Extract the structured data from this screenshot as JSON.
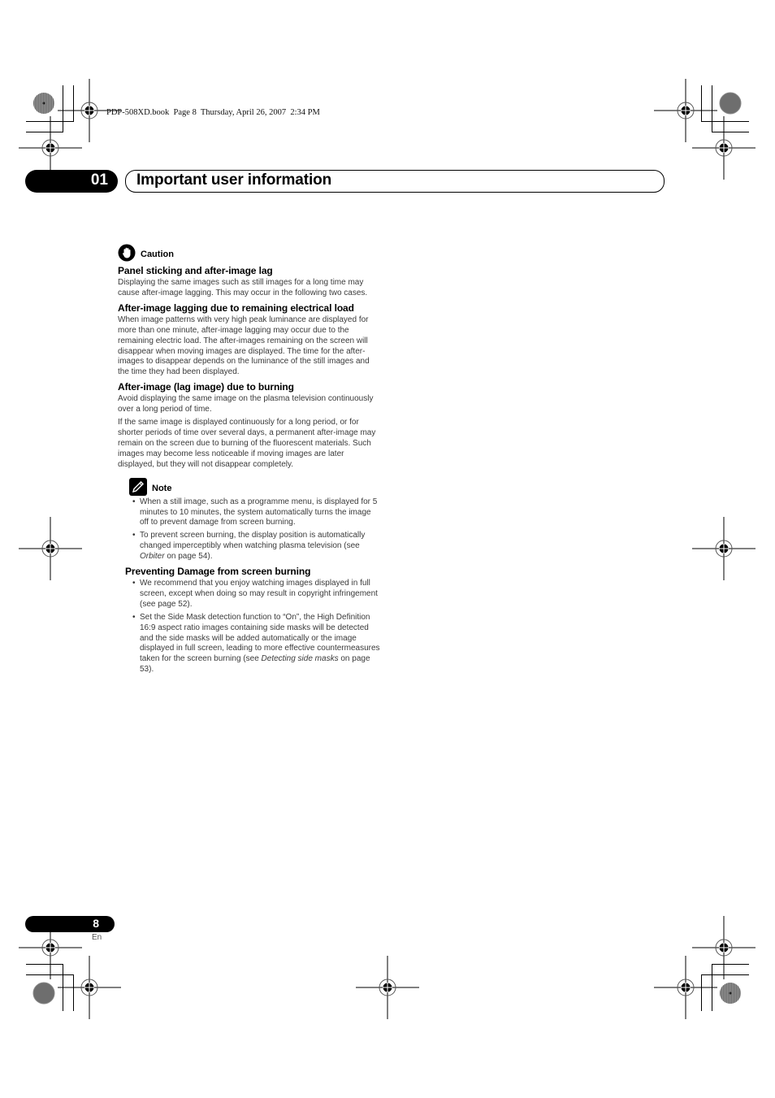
{
  "print_header": "PDP-508XD.book  Page 8  Thursday, April 26, 2007  2:34 PM",
  "chapter": {
    "number": "01",
    "title": "Important user information"
  },
  "caution": {
    "label": "Caution",
    "icon": "hand-stop-icon",
    "sections": [
      {
        "heading": "Panel sticking and after-image lag",
        "paragraphs": [
          "Displaying the same images such as still images for a long time may cause after-image lagging. This may occur in the following two cases."
        ]
      },
      {
        "heading": "After-image lagging due to remaining electrical load",
        "paragraphs": [
          "When image patterns with very high peak luminance are displayed for more than one minute, after-image lagging may occur due to the remaining electric load. The after-images remaining on the screen will disappear when moving images are displayed. The time for the after-images to disappear depends on the luminance of the still images and the time they had been displayed."
        ]
      },
      {
        "heading": "After-image (lag image) due to burning",
        "paragraphs": [
          "Avoid displaying the same image on the plasma television continuously over a long period of time.",
          "If the same image is displayed continuously for a long period, or for shorter periods of time over several days, a permanent after-image may remain on the screen due to burning of the fluorescent materials. Such images may become less noticeable if moving images are later displayed, but they will not disappear completely."
        ]
      }
    ]
  },
  "note": {
    "label": "Note",
    "icon": "pencil-note-icon",
    "bullets": [
      {
        "text": "When a still image, such as a programme menu, is displayed for 5 minutes to 10 minutes, the system automatically turns the image off to prevent damage from screen burning."
      },
      {
        "pre": "To prevent screen burning, the display position is automatically changed imperceptibly when watching plasma television (see ",
        "em": "Orbiter",
        "post": " on page 54)."
      }
    ]
  },
  "preventing": {
    "heading": "Preventing Damage from screen burning",
    "bullets": [
      {
        "text": "We recommend that you enjoy watching images displayed in full screen, except when doing so may result in copyright infringement (see page 52)."
      },
      {
        "pre": "Set the Side Mask detection function to “On”, the High Definition 16:9 aspect ratio images containing side masks will be detected and the side masks will be added automatically or the image displayed in full screen, leading to more effective countermeasures taken for the screen burning (see ",
        "em": "Detecting side masks",
        "post": " on page 53)."
      }
    ]
  },
  "footer": {
    "page_number": "8",
    "language": "En"
  }
}
